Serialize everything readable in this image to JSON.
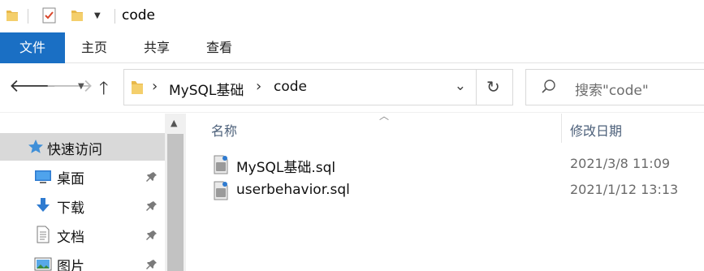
{
  "window": {
    "title": "code"
  },
  "quick_access_toolbar": {
    "items": [
      "folder-icon",
      "properties-icon",
      "new-folder-icon",
      "customize-dropdown-icon"
    ]
  },
  "ribbon": {
    "tabs": [
      {
        "label": "文件",
        "active": true
      },
      {
        "label": "主页"
      },
      {
        "label": "共享"
      },
      {
        "label": "查看"
      }
    ]
  },
  "address_bar": {
    "breadcrumbs": [
      "MySQL基础",
      "code"
    ]
  },
  "search": {
    "placeholder": "搜索\"code\""
  },
  "nav_pane": {
    "items": [
      {
        "label": "快速访问",
        "icon": "star-icon",
        "selected": true
      },
      {
        "label": "桌面",
        "icon": "desktop-icon",
        "pinned": true
      },
      {
        "label": "下载",
        "icon": "download-icon",
        "pinned": true
      },
      {
        "label": "文档",
        "icon": "document-icon",
        "pinned": true
      },
      {
        "label": "图片",
        "icon": "picture-icon",
        "pinned": true
      }
    ]
  },
  "file_list": {
    "columns": {
      "name": "名称",
      "date": "修改日期"
    },
    "rows": [
      {
        "name": "MySQL基础.sql",
        "date": "2021/3/8 11:09"
      },
      {
        "name": "userbehavior.sql",
        "date": "2021/1/12 13:13"
      }
    ]
  },
  "colors": {
    "file_tab": "#1a6fc4",
    "folder": "#e8b84a",
    "column_header": "#4c607a",
    "selection": "#d9d9d9"
  }
}
